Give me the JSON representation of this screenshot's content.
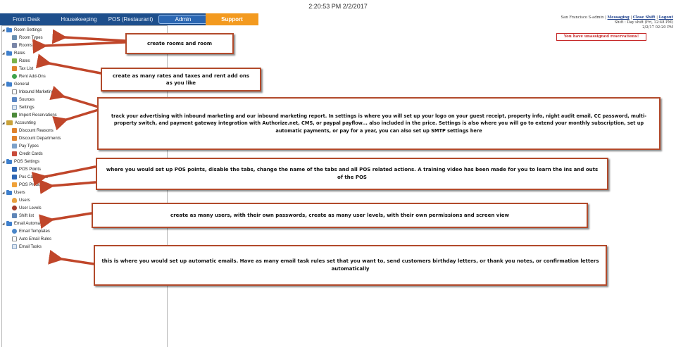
{
  "clock": "2:20:53 PM 2/2/2017",
  "nav": {
    "front_desk": "Front Desk",
    "housekeeping": "Housekeeping",
    "pos": "POS (Restaurant)",
    "admin": "Admin",
    "support": "Support"
  },
  "top_right": {
    "user": "San Francisco S-admin",
    "separator": "|",
    "messaging": "Messaging",
    "close_shift": "Close Shift",
    "logout": "Logout",
    "shift_line": "Shift : Day shift (Fri, 12:48 PM)",
    "date_line": "2/2/17 02:20 PM"
  },
  "alert": "You have unassigned reservations!",
  "sidebar": {
    "room_settings": "Room Settings",
    "room_types": "Room Types",
    "rooms": "Rooms",
    "rates_group": "Rates",
    "rates": "Rates",
    "tax_list": "Tax List",
    "rent_addons": "Rent Add-Ons",
    "general": "General",
    "inbound_marketing": "Inbound Marketing",
    "sources": "Sources",
    "settings": "Settings",
    "import_reservations": "Import Reservations",
    "accounting": "Accounting",
    "discount_reasons": "Discount Reasons",
    "discount_departments": "Discount Departments",
    "pay_types": "Pay Types",
    "credit_cards": "Credit Cards",
    "pos_settings": "POS Settings",
    "pos_points": "POS Points",
    "pos_categories": "Pos Categories",
    "pos_products": "POS Products",
    "users_group": "Users",
    "users": "Users",
    "user_levels": "User Levels",
    "shift_list": "Shift list",
    "email_automation": "Email Automation",
    "email_templates": "Email Templates",
    "auto_email_rules": "Auto Email Rules",
    "email_tasks": "Email Tasks"
  },
  "callouts": {
    "rooms": "create rooms and room",
    "rates": "create as many rates and taxes and rent add ons as you like",
    "general": "track your advertising with inbound marketing and our inbound marketing report. In settings is where you will set up your logo on your guest receipt, property info, night audit email, CC password, multi-property switch, and payment gateway integration with Authorize.net, CMS, or paypal payflow... also included in the price. Settings is also where you will go to extend your monthly subscription, set up automatic payments, or pay for a year, you can also set up SMTP settings here",
    "pos": "where you would set up POS points, disable the tabs, change the name of the tabs and all POS related actions. A training video has been made for you to learn the ins and outs of the POS",
    "users": "create as many users, with their own passwords, create as many user levels, with their own permissions and screen view",
    "email": "this is where you would set up automatic emails. Have as many email task rules set that you want to, send customers birthday letters, or thank you notes, or confirmation letters automatically"
  },
  "colors": {
    "nav_bg": "#1e4f8c",
    "support": "#f39a1f",
    "callout_border": "#b24a2b",
    "arrow": "#c0462a",
    "alert": "#c62828"
  }
}
